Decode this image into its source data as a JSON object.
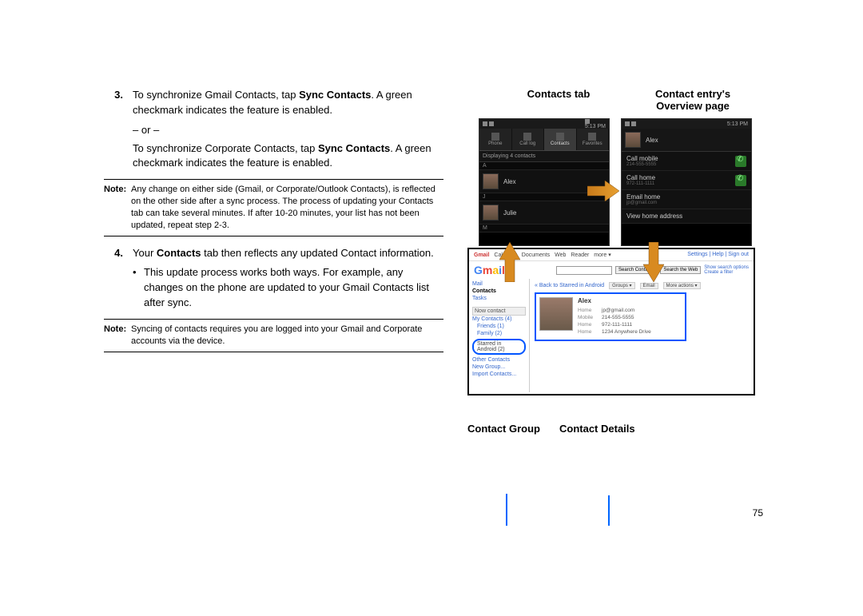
{
  "left": {
    "step3": {
      "num": "3.",
      "l1a": "To synchronize Gmail Contacts, tap ",
      "l1b": "Sync Contacts",
      "l1c": ". A green checkmark indicates the feature is enabled.",
      "or": "– or –",
      "l2a": "To synchronize Corporate Contacts, tap ",
      "l2b": "Sync Contacts",
      "l2c": ". A green checkmark indicates the feature is enabled."
    },
    "note1": {
      "label": "Note:",
      "text": "Any change on either side (Gmail, or Corporate/Outlook Contacts), is reflected on the other side after a sync process. The process of updating your Contacts tab can take several minutes. If after 10-20 minutes, your list has not been updated, repeat step 2-3."
    },
    "step4": {
      "num": "4.",
      "l1a": "Your ",
      "l1b": "Contacts",
      "l1c": " tab then reflects any updated Contact information.",
      "bullet": "•",
      "sub": "This update process works both ways. For example, any changes on the phone are updated to your Gmail Contacts list after sync."
    },
    "note2": {
      "label": "Note:",
      "text": "Syncing of contacts requires you are logged into your Gmail and Corporate accounts via the device."
    }
  },
  "captions": {
    "top_left": "Contacts tab",
    "top_right_l1": "Contact entry's",
    "top_right_l2": "Overview page",
    "bottom_left": "Contact Group",
    "bottom_right": "Contact Details"
  },
  "phoneA": {
    "time": "5:13 PM",
    "tabs": [
      "Phone",
      "Call log",
      "Contacts",
      "Favorites"
    ],
    "displaying": "Displaying 4 contacts",
    "sections": {
      "A": "A",
      "J": "J",
      "M": "M"
    },
    "contacts": [
      "Alex",
      "Julie"
    ]
  },
  "phoneB": {
    "time": "5:13 PM",
    "name": "Alex",
    "r1": {
      "label": "Call mobile",
      "sub": "214-555-5555"
    },
    "r2": {
      "label": "Call home",
      "sub": "972-111-1111"
    },
    "r3": {
      "label": "Email home",
      "sub": "jp@gmail.com"
    },
    "r4": {
      "label": "View home address"
    }
  },
  "gmail": {
    "nav": [
      "Gmail",
      "Calendar",
      "Documents",
      "Web",
      "Reader",
      "more ▾"
    ],
    "rightlinks": "Settings | Help | Sign out",
    "tips": "Show search options\nCreate a filter",
    "search_btn": "Search Contacts",
    "web_btn": "Search the Web",
    "sidebar": {
      "mail": "Mail",
      "contacts": "Contacts",
      "tasks": "Tasks",
      "now": "Now contact",
      "mycontacts": "My Contacts (4)",
      "friends": "Friends (1)",
      "family": "Family (2)",
      "starred": "Starred in Android (2)",
      "other": "Other Contacts",
      "newgroup": "New Group...",
      "import": "Import Contacts..."
    },
    "main": {
      "back": "« Back to Starred in Android",
      "groups": "Groups ▾",
      "email": "Email",
      "more": "More actions ▾",
      "name": "Alex",
      "r1": {
        "k": "Home",
        "v": "jp@gmail.com"
      },
      "r2": {
        "k": "Mobile",
        "v": "214-555-5555"
      },
      "r3": {
        "k": "Home",
        "v": "972-111-1111"
      },
      "r4": {
        "k": "Home",
        "v": "1234 Anywhere Drive"
      }
    }
  },
  "page_number": "75"
}
